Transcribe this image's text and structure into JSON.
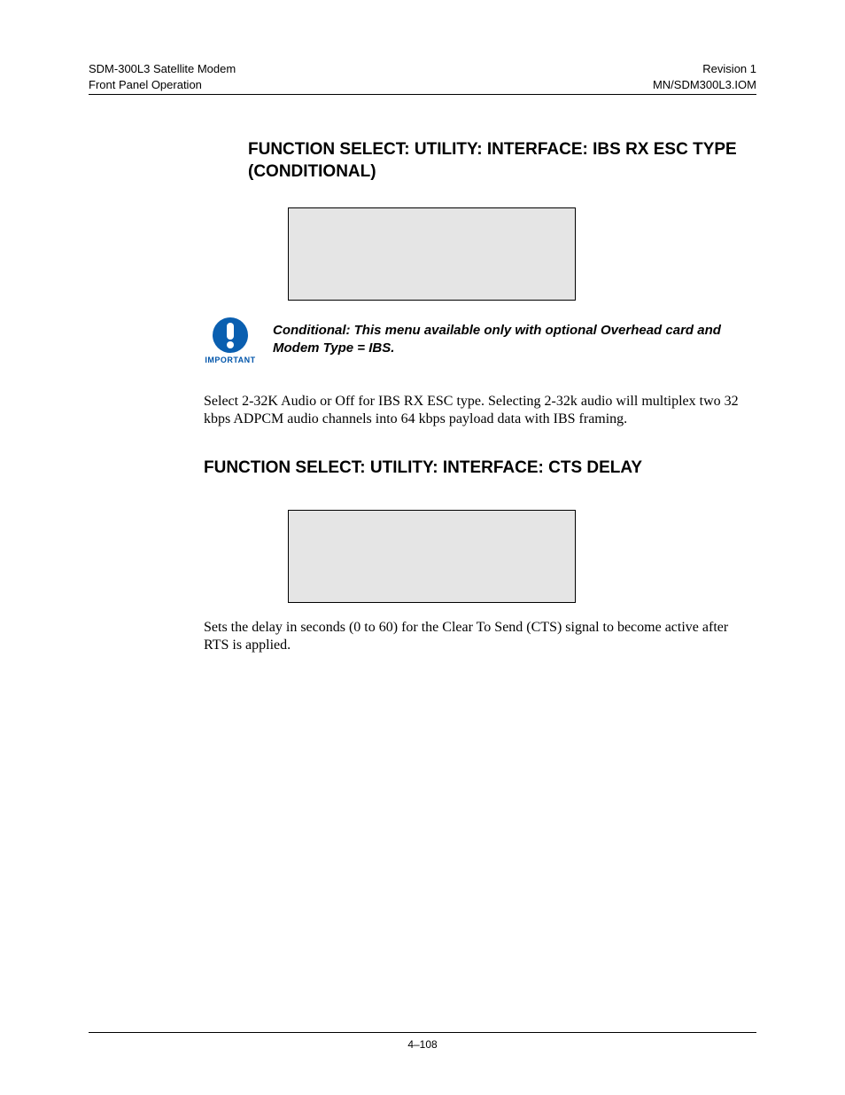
{
  "header": {
    "left_top": "SDM-300L3 Satellite Modem",
    "left_bottom": "Front Panel Operation",
    "right_top": "Revision 1",
    "right_bottom": "MN/SDM300L3.IOM"
  },
  "section1": {
    "heading": "FUNCTION SELECT: UTILITY: INTERFACE: IBS RX ESC TYPE (CONDITIONAL)",
    "important_label": "IMPORTANT",
    "important_text": "Conditional:  This menu available only with optional Overhead card and Modem Type = IBS.",
    "body": "Select 2-32K Audio or Off for IBS RX ESC type.  Selecting 2-32k audio will multiplex two 32 kbps ADPCM audio channels into 64 kbps payload data with IBS framing."
  },
  "section2": {
    "heading": "FUNCTION SELECT: UTILITY: INTERFACE: CTS DELAY",
    "body": "Sets the delay in seconds (0 to 60) for the Clear To Send (CTS) signal to become active after RTS is applied."
  },
  "footer": {
    "page_number": "4–108"
  }
}
